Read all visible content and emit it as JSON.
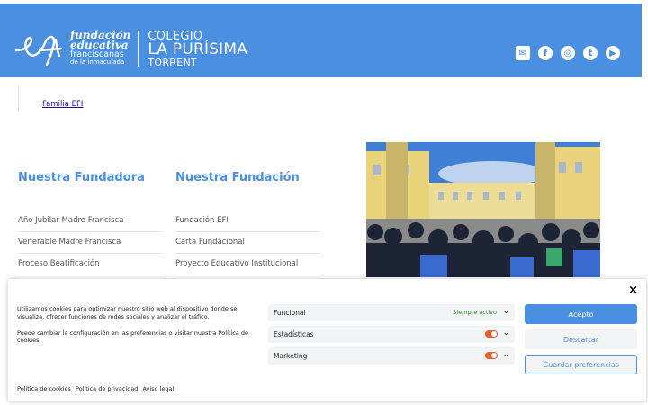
{
  "header": {
    "fundacion_lines": [
      "fundación",
      "educativa",
      "franciscanas",
      "de la inmaculada"
    ],
    "colegio_lines": [
      "COLEGIO",
      "LA PURÍSIMA",
      "TORRENT"
    ],
    "social_icons": [
      "mail-icon",
      "facebook-icon",
      "instagram-icon",
      "twitter-icon",
      "youtube-icon"
    ],
    "brand_color": "#4a8fe0"
  },
  "breadcrumb": {
    "label": "Familia EFI"
  },
  "columns": [
    {
      "title": "Nuestra Fundadora",
      "items": [
        "Año Jubilar Madre Francisca",
        "Venerable Madre Francisca",
        "Proceso Beatificación"
      ]
    },
    {
      "title": "Nuestra Fundación",
      "items": [
        "Fundación EFI",
        "Carta Fundacional",
        "Proyecto Educativo Institucional"
      ]
    }
  ],
  "cookie_banner": {
    "text1": "Utilizamos cookies para optimizar nuestro sitio web al dispositivo donde se visualiza, ofrecer funciones de redes sociales y analizar el tráfico.",
    "text2": "Puede cambiar la configuración en las preferencias o visitar nuestra Política de cookies.",
    "categories": [
      {
        "label": "Funcional",
        "status": "Siempre activo"
      },
      {
        "label": "Estadísticas"
      },
      {
        "label": "Marketing"
      }
    ],
    "accept": "Acepto",
    "deny": "Descartar",
    "save": "Guardar preferencias",
    "links": [
      "Política de cookies",
      "Política de privacidad",
      "Aviso legal"
    ],
    "close": "×"
  }
}
